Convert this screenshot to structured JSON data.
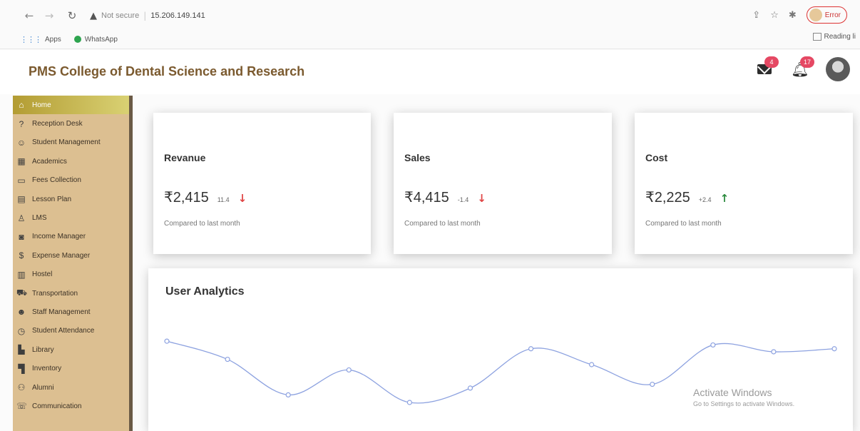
{
  "browser": {
    "security_label": "Not secure",
    "url": "15.206.149.141",
    "profile_label": "Error",
    "bookmarks": [
      "Apps",
      "WhatsApp"
    ],
    "reading_list": "Reading li"
  },
  "app": {
    "title": "PMS College of Dental Science and Research",
    "mail_count": "4",
    "notification_count": "17"
  },
  "sidebar": {
    "items": [
      {
        "label": "Home",
        "icon": "home-icon"
      },
      {
        "label": "Reception Desk",
        "icon": "help-icon"
      },
      {
        "label": "Student Management",
        "icon": "student-face-icon"
      },
      {
        "label": "Academics",
        "icon": "academics-icon"
      },
      {
        "label": "Fees Collection",
        "icon": "fees-icon"
      },
      {
        "label": "Lesson Plan",
        "icon": "lesson-plan-icon"
      },
      {
        "label": "LMS",
        "icon": "lms-icon"
      },
      {
        "label": "Income Manager",
        "icon": "income-icon"
      },
      {
        "label": "Expense Manager",
        "icon": "dollar-icon"
      },
      {
        "label": "Hostel",
        "icon": "hostel-icon"
      },
      {
        "label": "Transportation",
        "icon": "bus-icon"
      },
      {
        "label": "Staff Management",
        "icon": "staff-icon"
      },
      {
        "label": "Student Attendance",
        "icon": "clock-icon"
      },
      {
        "label": "Library",
        "icon": "library-icon"
      },
      {
        "label": "Inventory",
        "icon": "inventory-icon"
      },
      {
        "label": "Alumni",
        "icon": "alumni-icon"
      },
      {
        "label": "Communication",
        "icon": "phone-icon"
      }
    ]
  },
  "cards": [
    {
      "title": "Revanue",
      "value": "₹2,415",
      "delta": "11.4",
      "trend": "down",
      "subtitle": "Compared to last month"
    },
    {
      "title": "Sales",
      "value": "₹4,415",
      "delta": "-1.4",
      "trend": "down",
      "subtitle": "Compared to last month"
    },
    {
      "title": "Cost",
      "value": "₹2,225",
      "delta": "+2.4",
      "trend": "up",
      "subtitle": "Compared to last month"
    }
  ],
  "analytics": {
    "title": "User Analytics"
  },
  "chart_data": {
    "type": "line",
    "title": "User Analytics",
    "values": [
      0.81,
      0.57,
      0.1,
      0.43,
      0.0,
      0.19,
      0.71,
      0.5,
      0.24,
      0.76,
      0.67,
      0.71
    ],
    "line_color": "#8da2e0",
    "grid": false
  },
  "watermark": {
    "title": "Activate Windows",
    "subtitle": "Go to Settings to activate Windows."
  },
  "colors": {
    "brand": "#7b5a2f",
    "sidebar": "#dcbf91",
    "badge": "#e54863",
    "trend_down": "#e04545",
    "trend_up": "#2b8a3e"
  }
}
